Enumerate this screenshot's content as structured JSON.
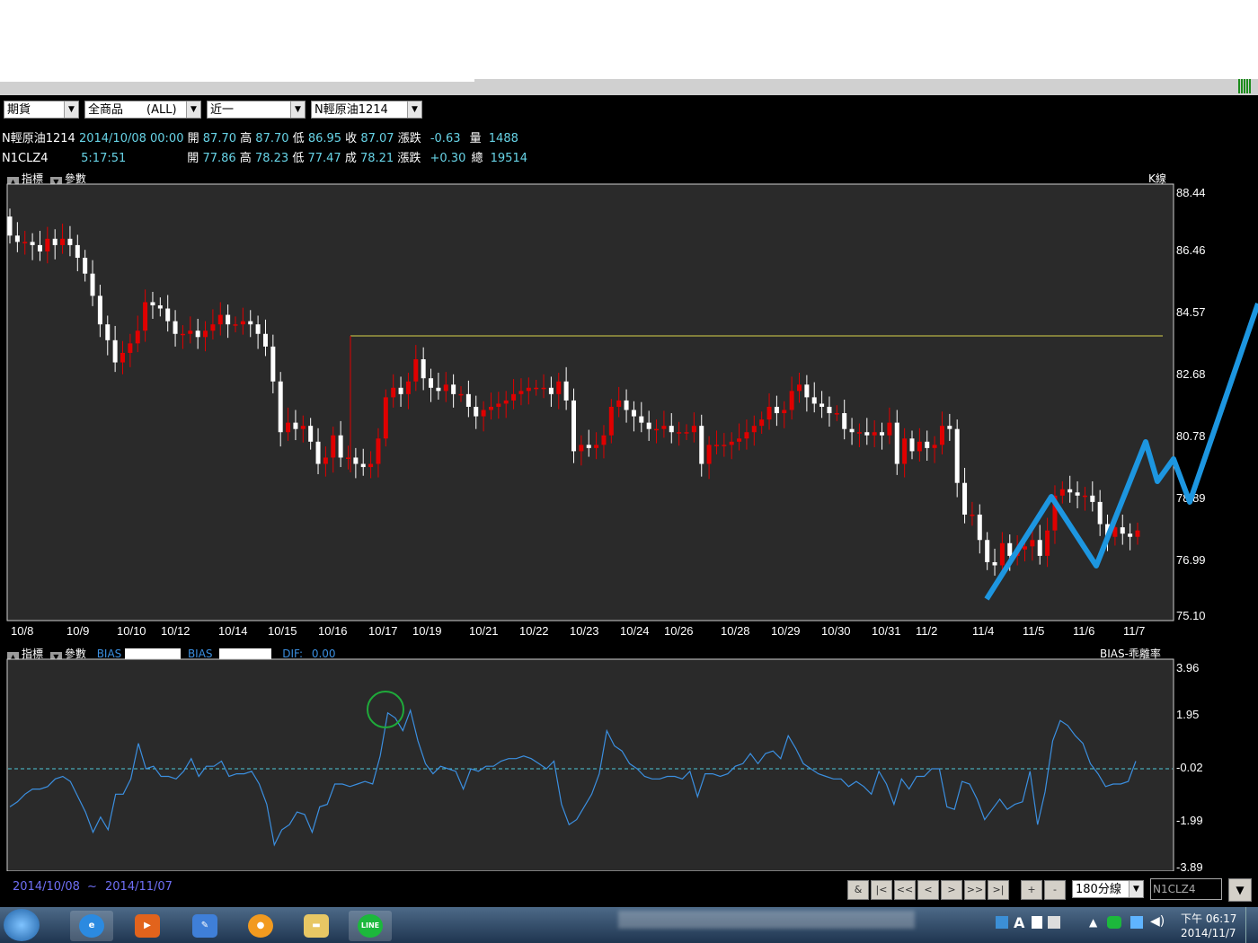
{
  "toolbar": {
    "category": "期貨",
    "product": "全商品　　(ALL)",
    "period": "近一",
    "symbol": "N輕原油1214"
  },
  "quote1": {
    "name": "N輕原油1214",
    "datetime": "2014/10/08 00:00",
    "open_label": "開",
    "open": "87.70",
    "high_label": "高",
    "high": "87.70",
    "low_label": "低",
    "low": "86.95",
    "close_label": "收",
    "close": "87.07",
    "change_label": "漲跌",
    "change": "-0.63",
    "vol_label": "量",
    "vol": "1488"
  },
  "quote2": {
    "name": "N1CLZ4",
    "time": "5:17:51",
    "open_label": "開",
    "open": "77.86",
    "high_label": "高",
    "high": "78.23",
    "low_label": "低",
    "low": "77.47",
    "last_label": "成",
    "last": "78.21",
    "change_label": "漲跌",
    "change": "+0.30",
    "total_label": "總",
    "total": "19514"
  },
  "main_panel": {
    "indicator_label": "指標",
    "param_label": "參數",
    "kline_label": "K線"
  },
  "sub_panel": {
    "indicator_label": "指標",
    "param_label": "參數",
    "bias1_label": "BIAS",
    "bias2_label": "BIAS",
    "dif_label": "DIF:",
    "dif_value": "0.00",
    "right_label": "BIAS-乖離率"
  },
  "colors": {
    "up": "#e00000",
    "down": "#ffffff",
    "bias_line": "#3b8fe0",
    "drawn_line": "#1d96e0",
    "resistance": "#d8d24a",
    "circle": "#1faa3a"
  },
  "chart_data": [
    {
      "type": "candlestick",
      "symbol": "N輕原油1214",
      "x_ticks": [
        "10/8",
        "10/9",
        "10/10",
        "10/12",
        "10/14",
        "10/15",
        "10/16",
        "10/17",
        "10/19",
        "10/21",
        "10/22",
        "10/23",
        "10/24",
        "10/26",
        "10/28",
        "10/29",
        "10/30",
        "10/31",
        "11/2",
        "11/4",
        "11/5",
        "11/6",
        "11/7"
      ],
      "y_ticks": [
        88.44,
        86.46,
        84.57,
        82.68,
        80.78,
        78.89,
        76.99,
        75.1
      ],
      "ylim": [
        75.1,
        88.44
      ],
      "grid": false,
      "closes": [
        87.1,
        86.9,
        86.9,
        86.8,
        86.6,
        87.0,
        86.8,
        87.0,
        86.8,
        86.4,
        85.9,
        85.2,
        84.3,
        83.8,
        83.1,
        83.4,
        83.7,
        84.1,
        85.0,
        84.9,
        84.8,
        84.4,
        84.0,
        84.0,
        84.1,
        83.9,
        84.1,
        84.3,
        84.6,
        84.3,
        84.3,
        84.4,
        84.3,
        84.0,
        83.6,
        82.5,
        80.9,
        81.2,
        81.0,
        81.1,
        80.6,
        79.9,
        80.1,
        80.8,
        80.1,
        80.1,
        79.9,
        79.8,
        79.9,
        80.7,
        82.0,
        82.3,
        82.1,
        82.5,
        83.2,
        82.6,
        82.3,
        82.2,
        82.4,
        82.1,
        82.1,
        81.7,
        81.4,
        81.6,
        81.7,
        81.8,
        81.9,
        82.1,
        82.2,
        82.3,
        82.3,
        82.3,
        82.1,
        82.5,
        81.9,
        80.3,
        80.5,
        80.4,
        80.5,
        80.8,
        81.7,
        81.9,
        81.6,
        81.4,
        81.2,
        81.0,
        81.0,
        81.1,
        80.9,
        80.9,
        80.9,
        81.1,
        79.9,
        80.5,
        80.5,
        80.5,
        80.6,
        80.7,
        80.9,
        81.1,
        81.3,
        81.7,
        81.5,
        81.6,
        82.2,
        82.4,
        82.0,
        81.8,
        81.7,
        81.5,
        81.5,
        81.0,
        80.9,
        80.9,
        80.8,
        80.9,
        80.8,
        81.2,
        79.9,
        80.7,
        80.3,
        80.6,
        80.4,
        80.5,
        81.1,
        81.0,
        79.3,
        78.3,
        78.3,
        77.5,
        76.8,
        76.7,
        77.4,
        77.0,
        77.2,
        77.3,
        77.5,
        77.0,
        77.8,
        78.9,
        79.1,
        79.0,
        78.9,
        78.9,
        78.7,
        78.0,
        77.6,
        77.9,
        77.7,
        77.6,
        77.8
      ]
    },
    {
      "type": "line",
      "indicator": "BIAS",
      "y_ticks": [
        3.96,
        1.95,
        -0.02,
        -1.99,
        -3.89
      ],
      "ylim": [
        -3.89,
        3.96
      ],
      "values": [
        -1.5,
        -1.3,
        -1.0,
        -0.8,
        -0.8,
        -0.7,
        -0.4,
        -0.3,
        -0.5,
        -1.1,
        -1.7,
        -2.5,
        -1.9,
        -2.4,
        -1.0,
        -1.0,
        -0.4,
        1.0,
        0.0,
        0.1,
        -0.3,
        -0.3,
        -0.4,
        -0.1,
        0.4,
        -0.3,
        0.1,
        0.1,
        0.3,
        -0.3,
        -0.2,
        -0.2,
        -0.1,
        -0.6,
        -1.4,
        -3.0,
        -2.4,
        -2.2,
        -1.7,
        -1.8,
        -2.5,
        -1.5,
        -1.4,
        -0.6,
        -0.6,
        -0.7,
        -0.6,
        -0.5,
        -0.6,
        0.5,
        2.2,
        2.0,
        1.5,
        2.3,
        1.1,
        0.2,
        -0.2,
        0.1,
        0.0,
        -0.1,
        -0.8,
        0.0,
        -0.1,
        0.1,
        0.1,
        0.3,
        0.4,
        0.4,
        0.5,
        0.4,
        0.2,
        0.0,
        0.3,
        -1.4,
        -2.2,
        -2.0,
        -1.5,
        -1.0,
        -0.2,
        1.5,
        0.9,
        0.7,
        0.2,
        0.0,
        -0.3,
        -0.4,
        -0.4,
        -0.3,
        -0.3,
        -0.4,
        -0.1,
        -1.1,
        -0.2,
        -0.2,
        -0.3,
        -0.2,
        0.1,
        0.2,
        0.6,
        0.2,
        0.6,
        0.7,
        0.4,
        1.3,
        0.8,
        0.2,
        0.0,
        -0.2,
        -0.3,
        -0.4,
        -0.4,
        -0.7,
        -0.5,
        -0.7,
        -1.0,
        -0.1,
        -0.6,
        -1.4,
        -0.4,
        -0.8,
        -0.3,
        -0.3,
        0.0,
        0.0,
        -1.5,
        -1.6,
        -0.5,
        -0.6,
        -1.2,
        -2.0,
        -1.6,
        -1.2,
        -1.6,
        -1.4,
        -1.3,
        -0.1,
        -2.2,
        -0.9,
        1.1,
        1.9,
        1.7,
        1.3,
        1.0,
        0.2,
        -0.2,
        -0.7,
        -0.6,
        -0.6,
        -0.5,
        0.3
      ],
      "annotation": "circle at peak near 10/17"
    }
  ],
  "bottom": {
    "date_from": "2014/10/08",
    "tilde": "~",
    "date_to": "2014/11/07",
    "nav": [
      "&",
      "|<",
      "<<",
      "<",
      ">",
      ">>",
      ">|"
    ],
    "zoom_in": "+",
    "zoom_out": "-",
    "interval": "180分線",
    "symbol_box": "N1CLZ4"
  },
  "taskbar": {
    "apps": [
      "start-orb",
      "internet-explorer",
      "media-player",
      "paint-brush",
      "orange-app",
      "folder",
      "line"
    ],
    "line_label": "LINE",
    "clock_top": "下午 06:17",
    "clock_date": "2014/11/7",
    "ime_label": "A"
  }
}
